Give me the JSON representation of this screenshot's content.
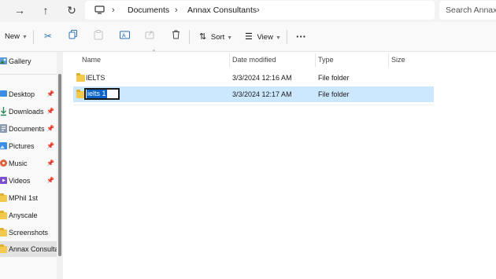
{
  "nav": {
    "forward_icon": "arrow-right-icon",
    "up_icon": "arrow-up-icon",
    "refresh_icon": "refresh-icon"
  },
  "address": {
    "location_icon": "monitor-icon",
    "crumbs": [
      "Documents",
      "Annax Consultants"
    ]
  },
  "search": {
    "placeholder": "Search Annax Consultants"
  },
  "commands": {
    "new_label": "New",
    "sort_label": "Sort",
    "view_label": "View"
  },
  "sidebar": {
    "items": [
      {
        "label": "Gallery",
        "icon": "gallery-icon",
        "pinned": false
      },
      {
        "label": "Desktop",
        "icon": "desktop-icon",
        "pinned": true
      },
      {
        "label": "Downloads",
        "icon": "download-icon",
        "pinned": true
      },
      {
        "label": "Documents",
        "icon": "documents-icon",
        "pinned": true
      },
      {
        "label": "Pictures",
        "icon": "pictures-icon",
        "pinned": true
      },
      {
        "label": "Music",
        "icon": "music-icon",
        "pinned": true
      },
      {
        "label": "Videos",
        "icon": "videos-icon",
        "pinned": true
      },
      {
        "label": "MPhil 1st",
        "icon": "folder-icon",
        "pinned": false
      },
      {
        "label": "Anyscale",
        "icon": "folder-icon",
        "pinned": false
      },
      {
        "label": "Screenshots",
        "icon": "folder-icon",
        "pinned": false
      },
      {
        "label": "Annax Consultants",
        "icon": "folder-icon",
        "pinned": false,
        "selected": true
      }
    ]
  },
  "columns": {
    "name": "Name",
    "date": "Date modified",
    "type": "Type",
    "size": "Size"
  },
  "files": [
    {
      "name": "IELTS",
      "date": "3/3/2024 12:16 AM",
      "type": "File folder",
      "size": ""
    },
    {
      "name": "ielts 1",
      "date": "3/3/2024 12:17 AM",
      "type": "File folder",
      "size": "",
      "renaming": true,
      "selected": true
    }
  ],
  "colors": {
    "selection": "#cce8ff",
    "folder": "#f2c94c",
    "text_highlight": "#0a64c8"
  }
}
